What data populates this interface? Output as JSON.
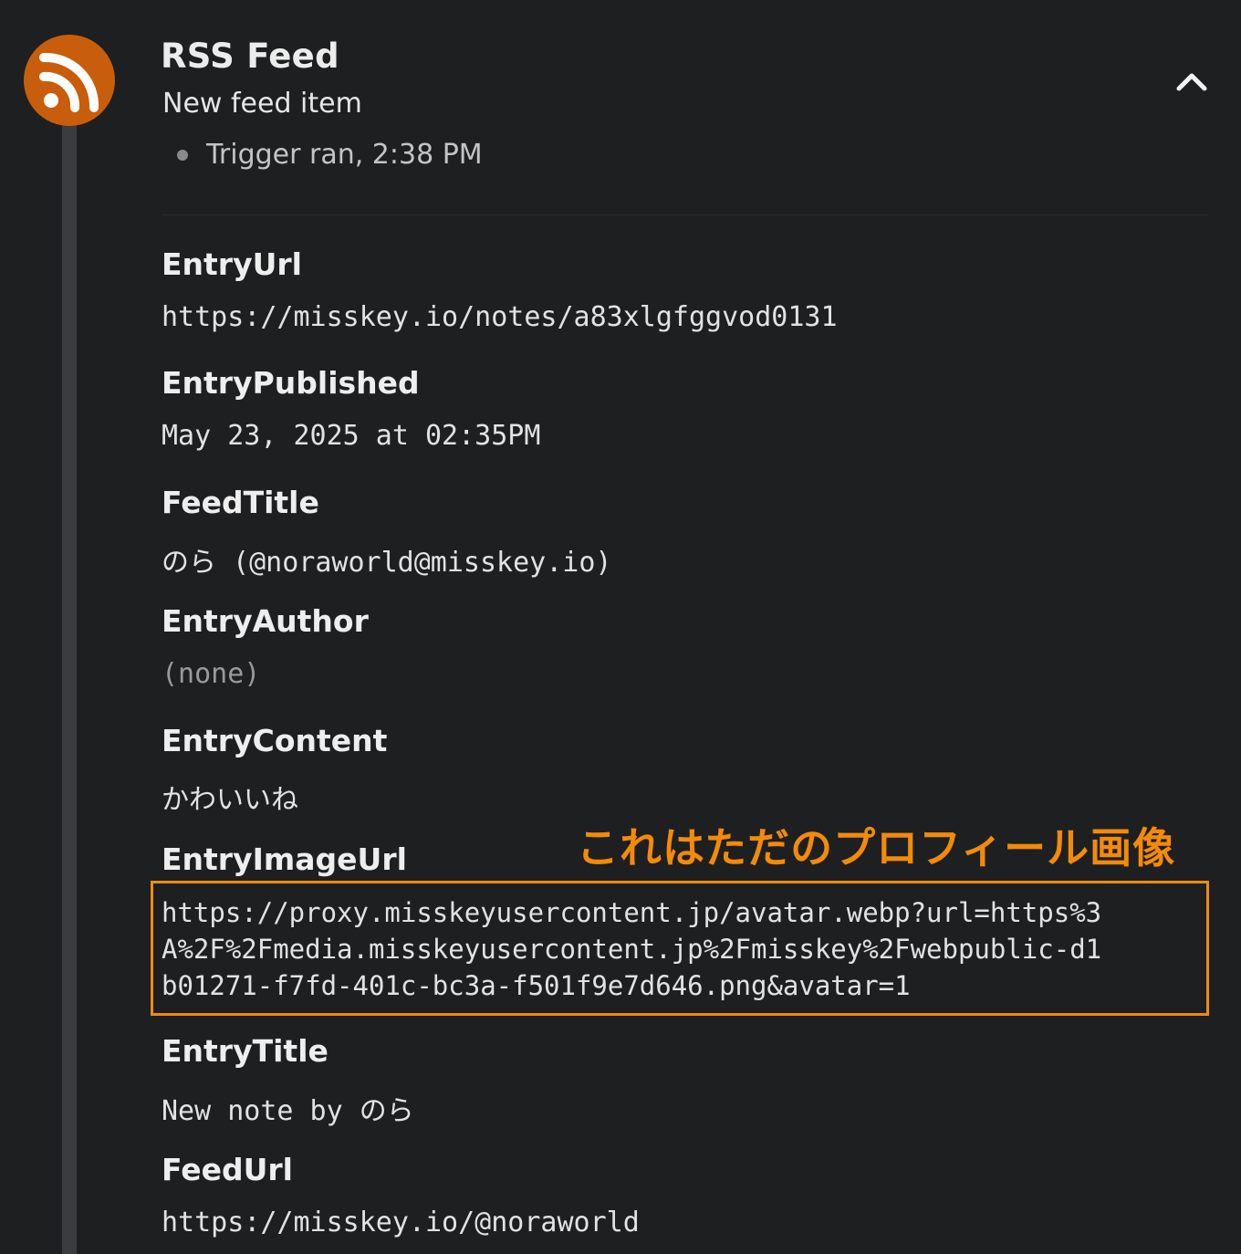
{
  "header": {
    "title": "RSS Feed",
    "subtitle": "New feed item",
    "trigger_status": "Trigger ran, 2:38 PM",
    "brand_color": "#c85e0b"
  },
  "fields": [
    {
      "label": "EntryUrl",
      "value": "https://misskey.io/notes/a83xlgfggvod0131"
    },
    {
      "label": "EntryPublished",
      "value": "May 23, 2025 at 02:35PM"
    },
    {
      "label": "FeedTitle",
      "value": "のら (@noraworld@misskey.io)"
    },
    {
      "label": "EntryAuthor",
      "value": "(none)"
    },
    {
      "label": "EntryContent",
      "value": "かわいいね"
    },
    {
      "label": "EntryImageUrl",
      "value_lines": [
        "https://proxy.misskeyusercontent.jp/avatar.webp?url=https%3",
        "A%2F%2Fmedia.misskeyusercontent.jp%2Fmisskey%2Fwebpublic-d1",
        "b01271-f7fd-401c-bc3a-f501f9e7d646.png&avatar=1"
      ]
    },
    {
      "label": "EntryTitle",
      "value": "New note by のら"
    },
    {
      "label": "FeedUrl",
      "value": "https://misskey.io/@noraworld"
    }
  ],
  "annotation": {
    "text": "これはただのプロフィール画像",
    "color": "#f28a0a"
  },
  "icons": {
    "avatar": "rss-icon",
    "collapse": "chevron-up-icon",
    "status": "dot-icon"
  }
}
